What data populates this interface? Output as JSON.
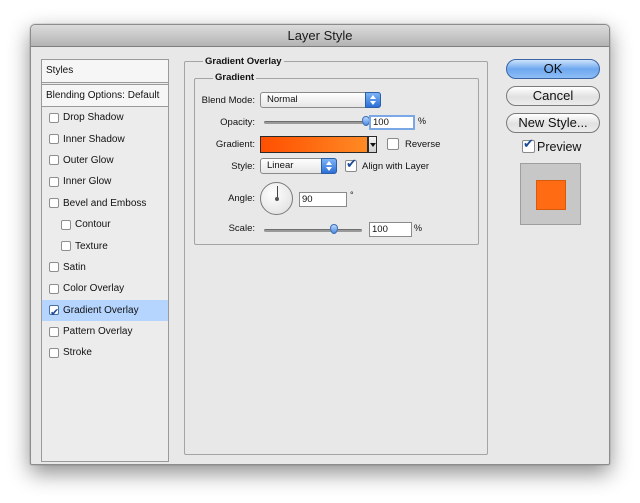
{
  "window": {
    "title": "Layer Style"
  },
  "style_list": {
    "header": "Styles",
    "blending_options": "Blending Options: Default",
    "items": [
      {
        "label": "Drop Shadow",
        "checked": false,
        "sub": false,
        "selected": false
      },
      {
        "label": "Inner Shadow",
        "checked": false,
        "sub": false,
        "selected": false
      },
      {
        "label": "Outer Glow",
        "checked": false,
        "sub": false,
        "selected": false
      },
      {
        "label": "Inner Glow",
        "checked": false,
        "sub": false,
        "selected": false
      },
      {
        "label": "Bevel and Emboss",
        "checked": false,
        "sub": false,
        "selected": false
      },
      {
        "label": "Contour",
        "checked": false,
        "sub": true,
        "selected": false
      },
      {
        "label": "Texture",
        "checked": false,
        "sub": true,
        "selected": false
      },
      {
        "label": "Satin",
        "checked": false,
        "sub": false,
        "selected": false
      },
      {
        "label": "Color Overlay",
        "checked": false,
        "sub": false,
        "selected": false
      },
      {
        "label": "Gradient Overlay",
        "checked": true,
        "sub": false,
        "selected": true
      },
      {
        "label": "Pattern Overlay",
        "checked": false,
        "sub": false,
        "selected": false
      },
      {
        "label": "Stroke",
        "checked": false,
        "sub": false,
        "selected": false
      }
    ]
  },
  "panel": {
    "title": "Gradient Overlay",
    "group_title": "Gradient",
    "blend_mode": {
      "label": "Blend Mode:",
      "value": "Normal"
    },
    "opacity": {
      "label": "Opacity:",
      "value": "100",
      "unit": "%",
      "level": 1.0
    },
    "gradient": {
      "label": "Gradient:",
      "start_color": "#ff4f00",
      "end_color": "#ff8a24"
    },
    "reverse": {
      "label": "Reverse",
      "checked": false
    },
    "style": {
      "label": "Style:",
      "value": "Linear"
    },
    "align_with_layer": {
      "label": "Align with Layer",
      "checked": true
    },
    "angle": {
      "label": "Angle:",
      "value": "90",
      "unit": "°"
    },
    "scale": {
      "label": "Scale:",
      "value": "100",
      "unit": "%",
      "level": 0.67
    }
  },
  "buttons": {
    "ok": "OK",
    "cancel": "Cancel",
    "new_style": "New Style..."
  },
  "preview": {
    "label": "Preview",
    "checked": true,
    "swatch_color": "#ff6b12"
  }
}
